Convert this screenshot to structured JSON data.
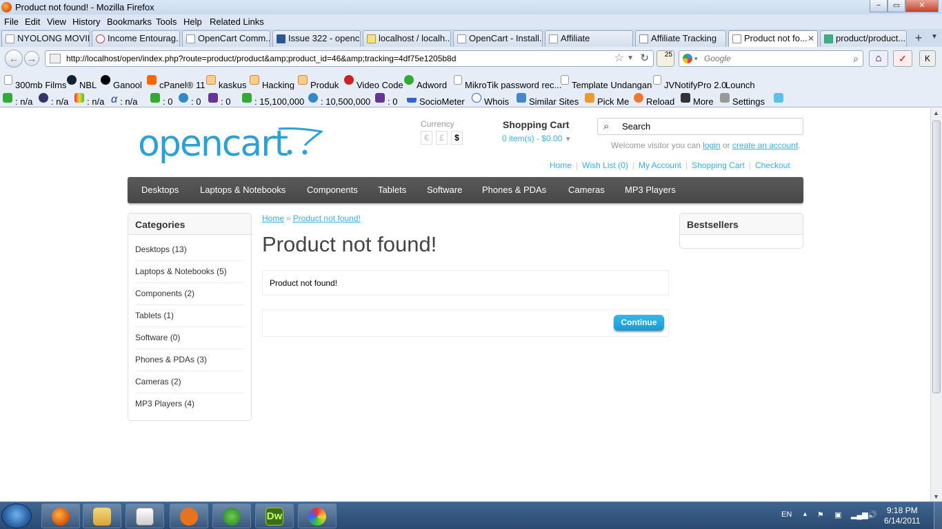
{
  "window": {
    "title": "Product not found! - Mozilla Firefox",
    "controls": [
      "−",
      "▭",
      "✕"
    ]
  },
  "menubar": [
    "File",
    "Edit",
    "View",
    "History",
    "Bookmarks",
    "Tools",
    "Help",
    "Related Links"
  ],
  "tabs": [
    {
      "label": "NYOLONG MOVIE"
    },
    {
      "label": "Income Entourag..."
    },
    {
      "label": "OpenCart Comm..."
    },
    {
      "label": "Issue 322 - openc..."
    },
    {
      "label": "localhost / localh..."
    },
    {
      "label": "OpenCart - Install..."
    },
    {
      "label": "Affiliate"
    },
    {
      "label": "Affiliate Tracking"
    },
    {
      "label": "Product not fo..."
    },
    {
      "label": "product/product..."
    }
  ],
  "navbar": {
    "url": "http://localhost/open/index.php?route=product/product&amp;product_id=46&amp;tracking=4df75e1205b8d",
    "search_placeholder": "Google",
    "badge": "25"
  },
  "bookmarks": [
    "300mb Films",
    "NBL",
    "Ganool",
    "cPanel® 11",
    "kaskus",
    "Hacking",
    "Produk",
    "Video Code",
    "Adword",
    "MikroTik password rec...",
    "Template Undangan",
    "JVNotifyPro 2.0",
    "Lounch"
  ],
  "seobar": [
    ": n/a",
    ": n/a",
    ": n/a",
    ": n/a",
    ": 0",
    ": 0",
    ": 0",
    ": 15,100,000",
    ": 10,500,000",
    ": 0",
    "SocioMeter",
    "Whois",
    "Similar Sites",
    "Pick Me",
    "Reload",
    "More",
    "Settings"
  ],
  "store": {
    "logo": "opencart",
    "currency_label": "Currency",
    "currencies": [
      "€",
      "£",
      "$"
    ],
    "cart_title": "Shopping Cart",
    "cart_items": "0 item(s) - $0.00",
    "search_value": "Search",
    "welcome_prefix": "Welcome visitor you can",
    "login": "login",
    "or": "or",
    "create_account": "create an account",
    "welcome_suffix": ".",
    "links": [
      "Home",
      "Wish List (0)",
      "My Account",
      "Shopping Cart",
      "Checkout"
    ],
    "menu": [
      "Desktops",
      "Laptops & Notebooks",
      "Components",
      "Tablets",
      "Software",
      "Phones & PDAs",
      "Cameras",
      "MP3 Players"
    ],
    "categories_title": "Categories",
    "categories": [
      "Desktops (13)",
      "Laptops & Notebooks (5)",
      "Components (2)",
      "Tablets (1)",
      "Software (0)",
      "Phones & PDAs (3)",
      "Cameras (2)",
      "MP3 Players (4)"
    ],
    "bestsellers_title": "Bestsellers",
    "breadcrumb": [
      "Home",
      "Product not found!"
    ],
    "breadcrumb_sep": "»",
    "heading": "Product not found!",
    "message": "Product not found!",
    "continue": "Continue"
  },
  "taskbar": {
    "lang": "EN",
    "time": "9:18 PM",
    "date": "6/14/2011",
    "dw": "Dw"
  }
}
